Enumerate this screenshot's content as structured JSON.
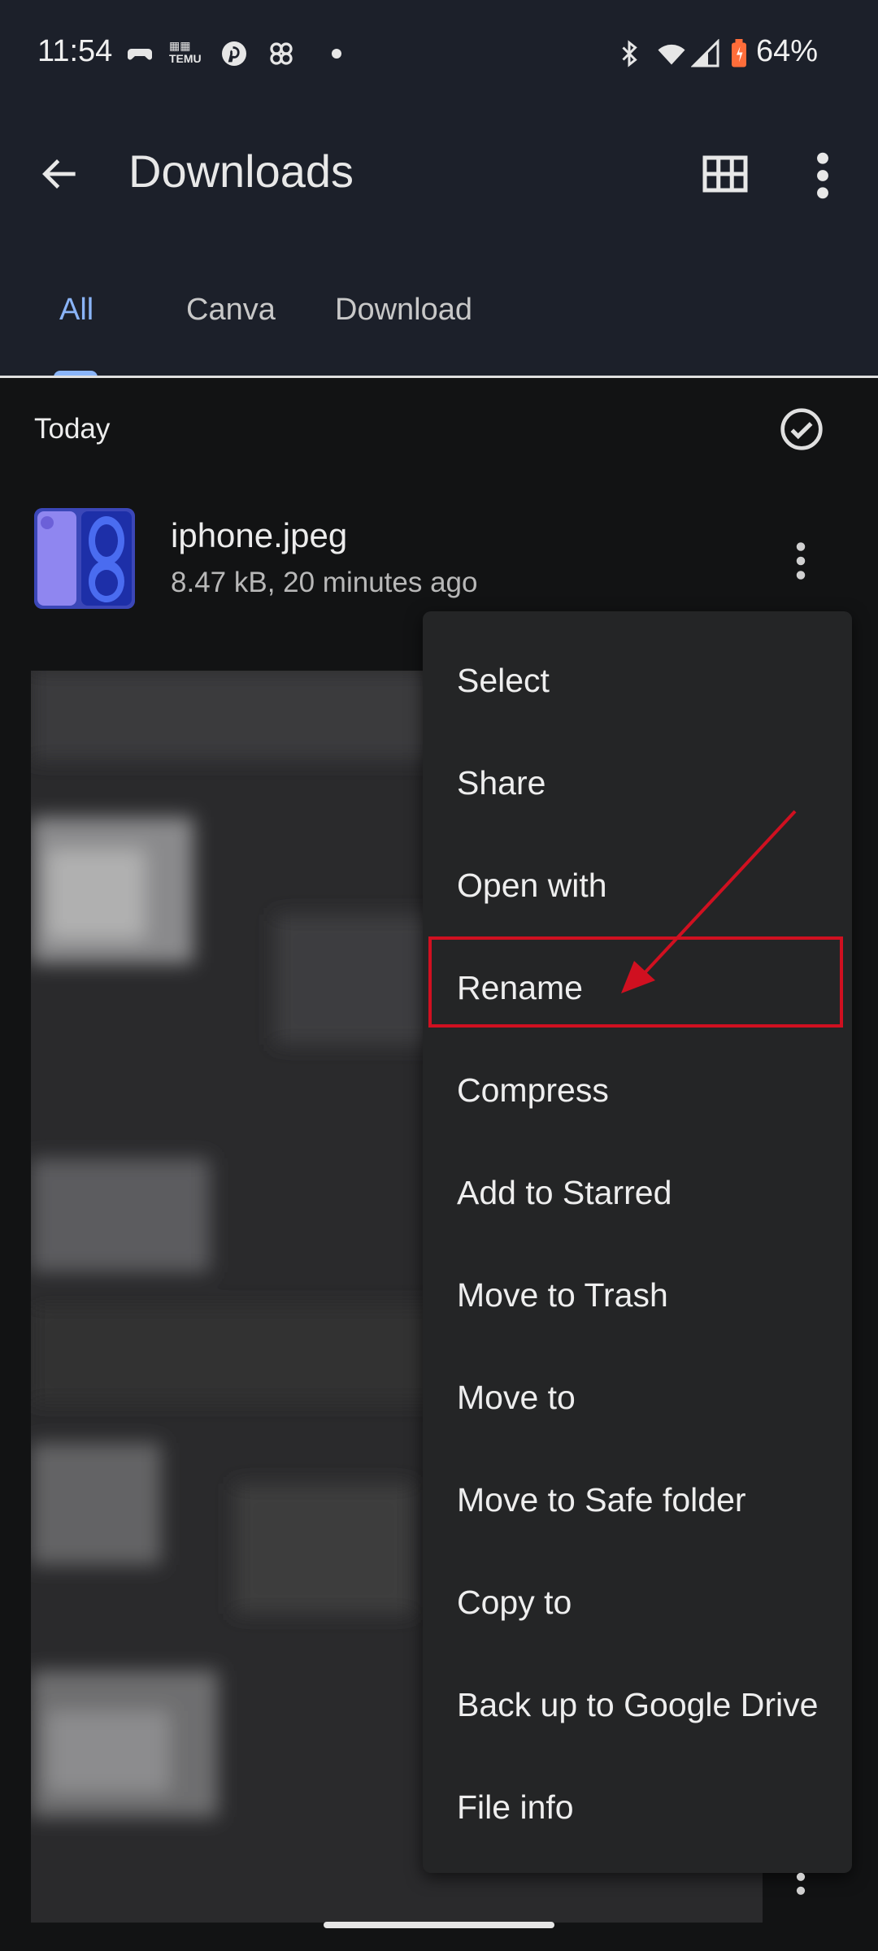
{
  "status_bar": {
    "time": "11:54",
    "battery": "64%"
  },
  "app_bar": {
    "title": "Downloads"
  },
  "tabs": [
    {
      "label": "All",
      "active": true
    },
    {
      "label": "Canva",
      "active": false
    },
    {
      "label": "Download",
      "active": false
    }
  ],
  "section": {
    "title": "Today"
  },
  "file": {
    "name": "iphone.jpeg",
    "meta": "8.47 kB, 20 minutes ago"
  },
  "menu": {
    "items": [
      "Select",
      "Share",
      "Open with",
      "Rename",
      "Compress",
      "Add to Starred",
      "Move to Trash",
      "Move to",
      "Move to Safe folder",
      "Copy to",
      "Back up to Google Drive",
      "File info"
    ],
    "highlighted": "Rename"
  },
  "colors": {
    "background": "#121314",
    "top_bar": "#1c202a",
    "accent": "#8ab4f8",
    "menu": "#242526",
    "annotation": "#d01020"
  },
  "icons": [
    "back-arrow-icon",
    "grid-view-icon",
    "more-vert-icon",
    "check-circle-icon",
    "bluetooth-icon",
    "wifi-icon",
    "signal-icon",
    "battery-icon"
  ]
}
